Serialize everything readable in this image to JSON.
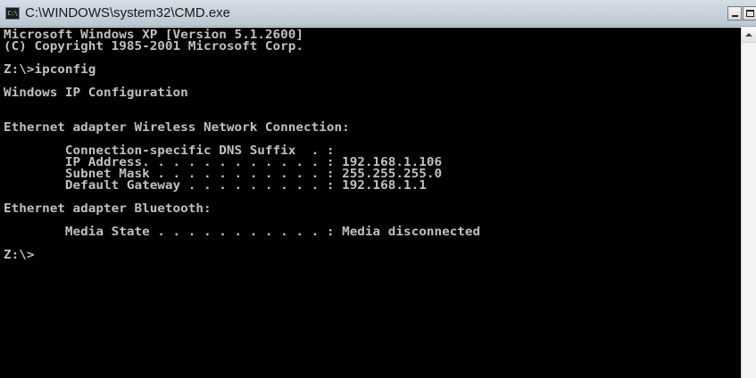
{
  "window": {
    "title": "C:\\WINDOWS\\system32\\CMD.exe",
    "icon_label": "C:\\"
  },
  "title_controls": {
    "minimize_icon": "minimize-icon",
    "maximize_icon": "maximize-icon"
  },
  "console": {
    "lines": [
      "Microsoft Windows XP [Version 5.1.2600]",
      "(C) Copyright 1985-2001 Microsoft Corp.",
      "",
      "Z:\\>ipconfig",
      "",
      "Windows IP Configuration",
      "",
      "",
      "Ethernet adapter Wireless Network Connection:",
      "",
      "        Connection-specific DNS Suffix  . :",
      "        IP Address. . . . . . . . . . . . : 192.168.1.106",
      "        Subnet Mask . . . . . . . . . . . : 255.255.255.0",
      "        Default Gateway . . . . . . . . . : 192.168.1.1",
      "",
      "Ethernet adapter Bluetooth:",
      "",
      "        Media State . . . . . . . . . . . : Media disconnected",
      "",
      "Z:\\>"
    ]
  },
  "colors": {
    "console_background": "#000000",
    "console_text": "#c0c0c0"
  }
}
